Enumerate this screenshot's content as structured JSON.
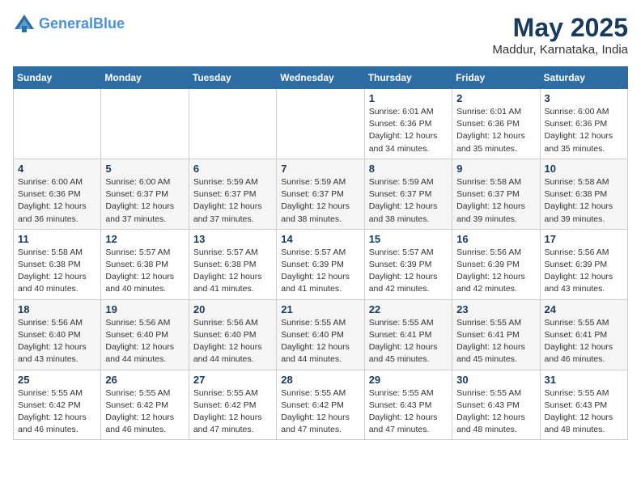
{
  "header": {
    "logo_line1": "General",
    "logo_line2": "Blue",
    "month_year": "May 2025",
    "location": "Maddur, Karnataka, India"
  },
  "weekdays": [
    "Sunday",
    "Monday",
    "Tuesday",
    "Wednesday",
    "Thursday",
    "Friday",
    "Saturday"
  ],
  "weeks": [
    [
      {
        "day": "",
        "info": ""
      },
      {
        "day": "",
        "info": ""
      },
      {
        "day": "",
        "info": ""
      },
      {
        "day": "",
        "info": ""
      },
      {
        "day": "1",
        "info": "Sunrise: 6:01 AM\nSunset: 6:36 PM\nDaylight: 12 hours\nand 34 minutes."
      },
      {
        "day": "2",
        "info": "Sunrise: 6:01 AM\nSunset: 6:36 PM\nDaylight: 12 hours\nand 35 minutes."
      },
      {
        "day": "3",
        "info": "Sunrise: 6:00 AM\nSunset: 6:36 PM\nDaylight: 12 hours\nand 35 minutes."
      }
    ],
    [
      {
        "day": "4",
        "info": "Sunrise: 6:00 AM\nSunset: 6:36 PM\nDaylight: 12 hours\nand 36 minutes."
      },
      {
        "day": "5",
        "info": "Sunrise: 6:00 AM\nSunset: 6:37 PM\nDaylight: 12 hours\nand 37 minutes."
      },
      {
        "day": "6",
        "info": "Sunrise: 5:59 AM\nSunset: 6:37 PM\nDaylight: 12 hours\nand 37 minutes."
      },
      {
        "day": "7",
        "info": "Sunrise: 5:59 AM\nSunset: 6:37 PM\nDaylight: 12 hours\nand 38 minutes."
      },
      {
        "day": "8",
        "info": "Sunrise: 5:59 AM\nSunset: 6:37 PM\nDaylight: 12 hours\nand 38 minutes."
      },
      {
        "day": "9",
        "info": "Sunrise: 5:58 AM\nSunset: 6:37 PM\nDaylight: 12 hours\nand 39 minutes."
      },
      {
        "day": "10",
        "info": "Sunrise: 5:58 AM\nSunset: 6:38 PM\nDaylight: 12 hours\nand 39 minutes."
      }
    ],
    [
      {
        "day": "11",
        "info": "Sunrise: 5:58 AM\nSunset: 6:38 PM\nDaylight: 12 hours\nand 40 minutes."
      },
      {
        "day": "12",
        "info": "Sunrise: 5:57 AM\nSunset: 6:38 PM\nDaylight: 12 hours\nand 40 minutes."
      },
      {
        "day": "13",
        "info": "Sunrise: 5:57 AM\nSunset: 6:38 PM\nDaylight: 12 hours\nand 41 minutes."
      },
      {
        "day": "14",
        "info": "Sunrise: 5:57 AM\nSunset: 6:39 PM\nDaylight: 12 hours\nand 41 minutes."
      },
      {
        "day": "15",
        "info": "Sunrise: 5:57 AM\nSunset: 6:39 PM\nDaylight: 12 hours\nand 42 minutes."
      },
      {
        "day": "16",
        "info": "Sunrise: 5:56 AM\nSunset: 6:39 PM\nDaylight: 12 hours\nand 42 minutes."
      },
      {
        "day": "17",
        "info": "Sunrise: 5:56 AM\nSunset: 6:39 PM\nDaylight: 12 hours\nand 43 minutes."
      }
    ],
    [
      {
        "day": "18",
        "info": "Sunrise: 5:56 AM\nSunset: 6:40 PM\nDaylight: 12 hours\nand 43 minutes."
      },
      {
        "day": "19",
        "info": "Sunrise: 5:56 AM\nSunset: 6:40 PM\nDaylight: 12 hours\nand 44 minutes."
      },
      {
        "day": "20",
        "info": "Sunrise: 5:56 AM\nSunset: 6:40 PM\nDaylight: 12 hours\nand 44 minutes."
      },
      {
        "day": "21",
        "info": "Sunrise: 5:55 AM\nSunset: 6:40 PM\nDaylight: 12 hours\nand 44 minutes."
      },
      {
        "day": "22",
        "info": "Sunrise: 5:55 AM\nSunset: 6:41 PM\nDaylight: 12 hours\nand 45 minutes."
      },
      {
        "day": "23",
        "info": "Sunrise: 5:55 AM\nSunset: 6:41 PM\nDaylight: 12 hours\nand 45 minutes."
      },
      {
        "day": "24",
        "info": "Sunrise: 5:55 AM\nSunset: 6:41 PM\nDaylight: 12 hours\nand 46 minutes."
      }
    ],
    [
      {
        "day": "25",
        "info": "Sunrise: 5:55 AM\nSunset: 6:42 PM\nDaylight: 12 hours\nand 46 minutes."
      },
      {
        "day": "26",
        "info": "Sunrise: 5:55 AM\nSunset: 6:42 PM\nDaylight: 12 hours\nand 46 minutes."
      },
      {
        "day": "27",
        "info": "Sunrise: 5:55 AM\nSunset: 6:42 PM\nDaylight: 12 hours\nand 47 minutes."
      },
      {
        "day": "28",
        "info": "Sunrise: 5:55 AM\nSunset: 6:42 PM\nDaylight: 12 hours\nand 47 minutes."
      },
      {
        "day": "29",
        "info": "Sunrise: 5:55 AM\nSunset: 6:43 PM\nDaylight: 12 hours\nand 47 minutes."
      },
      {
        "day": "30",
        "info": "Sunrise: 5:55 AM\nSunset: 6:43 PM\nDaylight: 12 hours\nand 48 minutes."
      },
      {
        "day": "31",
        "info": "Sunrise: 5:55 AM\nSunset: 6:43 PM\nDaylight: 12 hours\nand 48 minutes."
      }
    ]
  ]
}
